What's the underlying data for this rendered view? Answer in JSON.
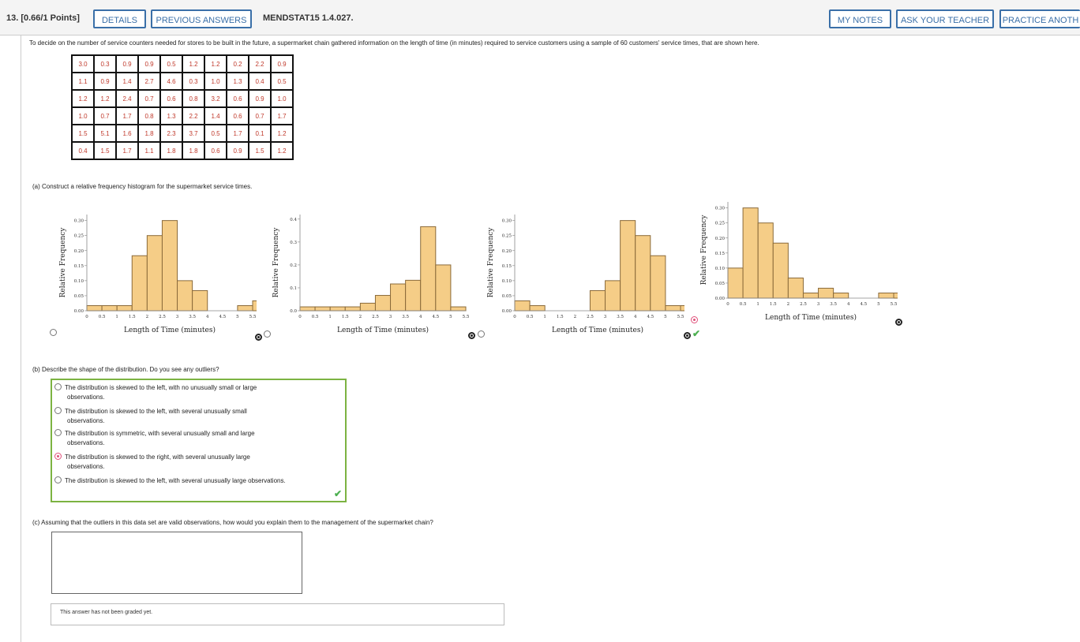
{
  "header": {
    "question_number": "13. [0.66/1 Points]",
    "details": "DETAILS",
    "previous_answers": "PREVIOUS ANSWERS",
    "code": "MENDSTAT15 1.4.027.",
    "my_notes": "MY NOTES",
    "ask_teacher": "ASK YOUR TEACHER",
    "practice": "PRACTICE ANOTH"
  },
  "intro": "To decide on the number of service counters needed for stores to be built in the future, a supermarket chain gathered information on the length of time (in minutes) required to service customers using a sample of 60 customers' service times, that are shown here.",
  "data_table": [
    [
      "3.0",
      "0.3",
      "0.9",
      "0.9",
      "0.5",
      "1.2",
      "1.2",
      "0.2",
      "2.2",
      "0.9"
    ],
    [
      "1.1",
      "0.9",
      "1.4",
      "2.7",
      "4.6",
      "0.3",
      "1.0",
      "1.3",
      "0.4",
      "0.5"
    ],
    [
      "1.2",
      "1.2",
      "2.4",
      "0.7",
      "0.6",
      "0.8",
      "3.2",
      "0.6",
      "0.9",
      "1.0"
    ],
    [
      "1.0",
      "0.7",
      "1.7",
      "0.8",
      "1.3",
      "2.2",
      "1.4",
      "0.6",
      "0.7",
      "1.7"
    ],
    [
      "1.5",
      "5.1",
      "1.6",
      "1.8",
      "2.3",
      "3.7",
      "0.5",
      "1.7",
      "0.1",
      "1.2"
    ],
    [
      "0.4",
      "1.5",
      "1.7",
      "1.1",
      "1.8",
      "1.8",
      "0.6",
      "0.9",
      "1.5",
      "1.2"
    ]
  ],
  "part_a": {
    "prompt": "(a)   Construct a relative frequency histogram for the supermarket service times.",
    "selected_index": 3
  },
  "chart_data": [
    {
      "type": "bar",
      "ylabel": "Relative Frequency",
      "xlabel": "Length of Time (minutes)",
      "xlim": [
        0,
        5.5
      ],
      "ylim": [
        0,
        0.32
      ],
      "yticks": [
        "0.00",
        "0.05",
        "0.10",
        "0.15",
        "0.20",
        "0.25",
        "0.30"
      ],
      "xticks": [
        "0",
        "0.5",
        "1",
        "1.5",
        "2",
        "2.5",
        "3",
        "3.5",
        "4",
        "4.5",
        "5",
        "5.5"
      ],
      "bin_width": 0.5,
      "bin_start": 0,
      "values": [
        0.017,
        0.017,
        0.017,
        0.183,
        0.25,
        0.3,
        0.1,
        0.067,
        0,
        0,
        0.017,
        0.033
      ],
      "colors": {
        "bar": "#f5cd87",
        "edge": "#8a6a3a"
      }
    },
    {
      "type": "bar",
      "ylabel": "Relative Frequency",
      "xlabel": "Length of Time (minutes)",
      "xlim": [
        0,
        5.5
      ],
      "ylim": [
        0,
        0.42
      ],
      "yticks": [
        "0.0",
        "0.1",
        "0.2",
        "0.3",
        "0.4"
      ],
      "xticks": [
        "0",
        "0.5",
        "1",
        "1.5",
        "2",
        "2.5",
        "3",
        "3.5",
        "4",
        "4.5",
        "5",
        "5.5"
      ],
      "bin_width": 0.5,
      "bin_start": 0,
      "values": [
        0.017,
        0.017,
        0.017,
        0.017,
        0.033,
        0.067,
        0.117,
        0.133,
        0.367,
        0.2,
        0.017
      ],
      "colors": {
        "bar": "#f5cd87",
        "edge": "#8a6a3a"
      }
    },
    {
      "type": "bar",
      "ylabel": "Relative Frequency",
      "xlabel": "Length of Time (minutes)",
      "xlim": [
        0,
        5.5
      ],
      "ylim": [
        0,
        0.32
      ],
      "yticks": [
        "0.00",
        "0.05",
        "0.10",
        "0.15",
        "0.20",
        "0.25",
        "0.30"
      ],
      "xticks": [
        "0",
        "0.5",
        "1",
        "1.5",
        "2",
        "2.5",
        "3",
        "3.5",
        "4",
        "4.5",
        "5",
        "5.5"
      ],
      "bin_width": 0.5,
      "bin_start": 0,
      "values": [
        0.033,
        0.017,
        0,
        0,
        0,
        0.067,
        0.1,
        0.3,
        0.25,
        0.183,
        0.017,
        0.017,
        0.017
      ],
      "colors": {
        "bar": "#f5cd87",
        "edge": "#8a6a3a"
      }
    },
    {
      "type": "bar",
      "ylabel": "Relative Frequency",
      "xlabel": "Length of Time (minutes)",
      "xlim": [
        0,
        5.5
      ],
      "ylim": [
        0,
        0.32
      ],
      "yticks": [
        "0.00",
        "0.05",
        "0.10",
        "0.15",
        "0.20",
        "0.25",
        "0.30"
      ],
      "xticks": [
        "0",
        "0.5",
        "1",
        "1.5",
        "2",
        "2.5",
        "3",
        "3.5",
        "4",
        "4.5",
        "5",
        "5.5"
      ],
      "bin_width": 0.5,
      "bin_start": 0,
      "values": [
        0.1,
        0.3,
        0.25,
        0.183,
        0.067,
        0.017,
        0.033,
        0.017,
        0,
        0,
        0.017,
        0.017
      ],
      "colors": {
        "bar": "#f5cd87",
        "edge": "#8a6a3a"
      }
    }
  ],
  "part_b": {
    "prompt": "(b)   Describe the shape of the distribution. Do you see any outliers?",
    "options": [
      {
        "line1": "The distribution is skewed to the left, with no unusually small or large",
        "line2": "observations."
      },
      {
        "line1": "The distribution is skewed to the left, with several unusually small",
        "line2": "observations."
      },
      {
        "line1": "The distribution is symmetric, with several unusually small and large",
        "line2": "observations."
      },
      {
        "line1": "The distribution is skewed to the right, with several unusually large",
        "line2": "observations."
      },
      {
        "line1": "The distribution is skewed to the left, with several unusually large observations.",
        "line2": ""
      }
    ],
    "selected_index": 3
  },
  "part_c": {
    "prompt": "(c)   Assuming that the outliers in this data set are valid observations, how would you explain them to the management of the supermarket chain?",
    "answer": "",
    "graded_note": "This answer has not been graded yet."
  },
  "colors": {
    "accent": "#3a6fa8",
    "correct": "#7cb342",
    "selected": "#e0507a",
    "data_text": "#c0392b"
  }
}
